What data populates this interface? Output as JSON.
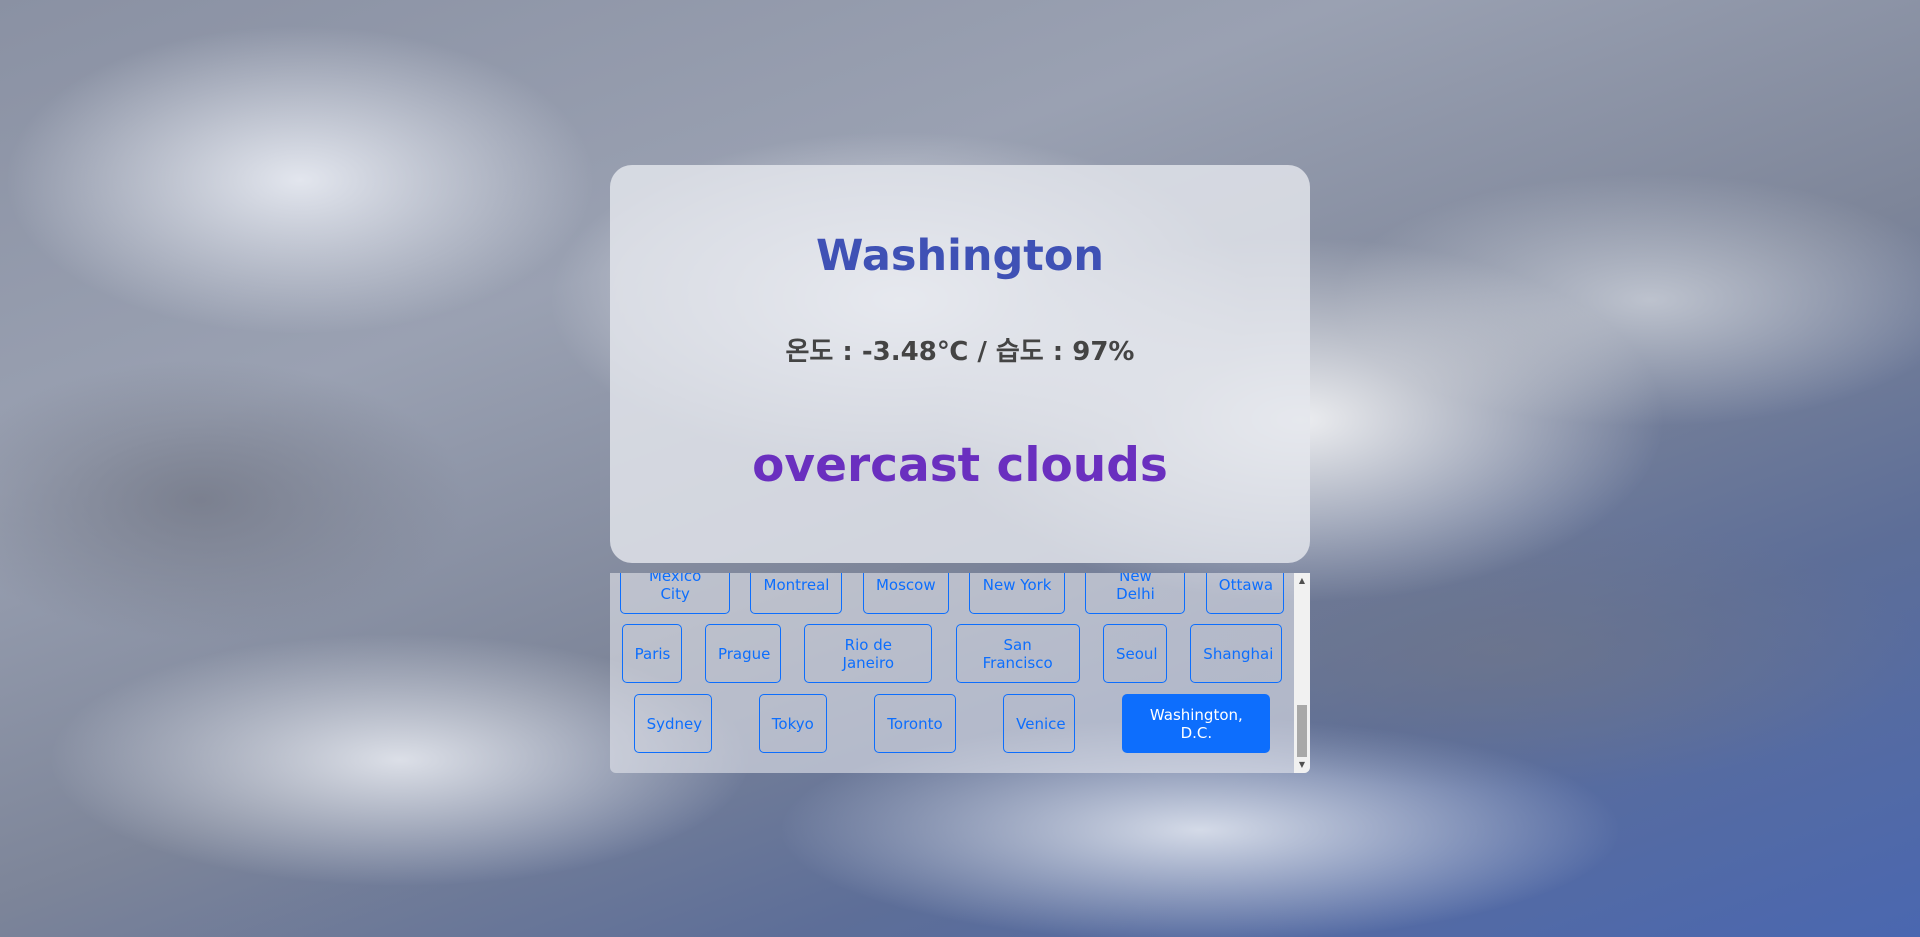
{
  "weather": {
    "city": "Washington",
    "stats_line": "온도 : -3.48℃ / 습도 : 97%",
    "description": "overcast clouds"
  },
  "city_buttons": {
    "rows": [
      [
        "Mexico City",
        "Montreal",
        "Moscow",
        "New York",
        "New Delhi",
        "Ottawa"
      ],
      [
        "Paris",
        "Prague",
        "Rio de Janeiro",
        "San Francisco",
        "Seoul",
        "Shanghai"
      ],
      [
        "Sydney",
        "Tokyo",
        "Toronto",
        "Venice",
        "Washington, D.C."
      ]
    ],
    "selected": "Washington, D.C."
  },
  "colors": {
    "accent": "#0d6efd",
    "city_title": "#3f51b5",
    "description": "#6a2fbf"
  },
  "icons": {
    "scroll_up": "triangle-up-icon",
    "scroll_down": "triangle-down-icon"
  }
}
